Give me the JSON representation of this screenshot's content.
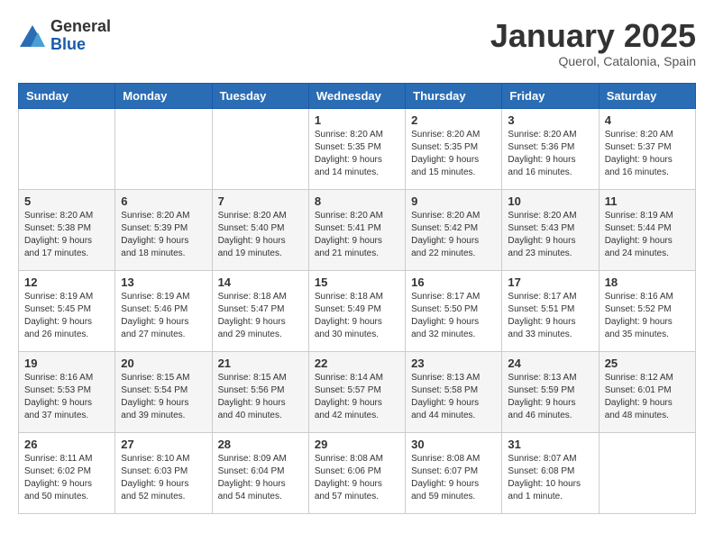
{
  "header": {
    "logo": {
      "general": "General",
      "blue": "Blue"
    },
    "title": "January 2025",
    "location": "Querol, Catalonia, Spain"
  },
  "weekdays": [
    "Sunday",
    "Monday",
    "Tuesday",
    "Wednesday",
    "Thursday",
    "Friday",
    "Saturday"
  ],
  "weeks": [
    [
      {
        "day": "",
        "info": ""
      },
      {
        "day": "",
        "info": ""
      },
      {
        "day": "",
        "info": ""
      },
      {
        "day": "1",
        "info": "Sunrise: 8:20 AM\nSunset: 5:35 PM\nDaylight: 9 hours\nand 14 minutes."
      },
      {
        "day": "2",
        "info": "Sunrise: 8:20 AM\nSunset: 5:35 PM\nDaylight: 9 hours\nand 15 minutes."
      },
      {
        "day": "3",
        "info": "Sunrise: 8:20 AM\nSunset: 5:36 PM\nDaylight: 9 hours\nand 16 minutes."
      },
      {
        "day": "4",
        "info": "Sunrise: 8:20 AM\nSunset: 5:37 PM\nDaylight: 9 hours\nand 16 minutes."
      }
    ],
    [
      {
        "day": "5",
        "info": "Sunrise: 8:20 AM\nSunset: 5:38 PM\nDaylight: 9 hours\nand 17 minutes."
      },
      {
        "day": "6",
        "info": "Sunrise: 8:20 AM\nSunset: 5:39 PM\nDaylight: 9 hours\nand 18 minutes."
      },
      {
        "day": "7",
        "info": "Sunrise: 8:20 AM\nSunset: 5:40 PM\nDaylight: 9 hours\nand 19 minutes."
      },
      {
        "day": "8",
        "info": "Sunrise: 8:20 AM\nSunset: 5:41 PM\nDaylight: 9 hours\nand 21 minutes."
      },
      {
        "day": "9",
        "info": "Sunrise: 8:20 AM\nSunset: 5:42 PM\nDaylight: 9 hours\nand 22 minutes."
      },
      {
        "day": "10",
        "info": "Sunrise: 8:20 AM\nSunset: 5:43 PM\nDaylight: 9 hours\nand 23 minutes."
      },
      {
        "day": "11",
        "info": "Sunrise: 8:19 AM\nSunset: 5:44 PM\nDaylight: 9 hours\nand 24 minutes."
      }
    ],
    [
      {
        "day": "12",
        "info": "Sunrise: 8:19 AM\nSunset: 5:45 PM\nDaylight: 9 hours\nand 26 minutes."
      },
      {
        "day": "13",
        "info": "Sunrise: 8:19 AM\nSunset: 5:46 PM\nDaylight: 9 hours\nand 27 minutes."
      },
      {
        "day": "14",
        "info": "Sunrise: 8:18 AM\nSunset: 5:47 PM\nDaylight: 9 hours\nand 29 minutes."
      },
      {
        "day": "15",
        "info": "Sunrise: 8:18 AM\nSunset: 5:49 PM\nDaylight: 9 hours\nand 30 minutes."
      },
      {
        "day": "16",
        "info": "Sunrise: 8:17 AM\nSunset: 5:50 PM\nDaylight: 9 hours\nand 32 minutes."
      },
      {
        "day": "17",
        "info": "Sunrise: 8:17 AM\nSunset: 5:51 PM\nDaylight: 9 hours\nand 33 minutes."
      },
      {
        "day": "18",
        "info": "Sunrise: 8:16 AM\nSunset: 5:52 PM\nDaylight: 9 hours\nand 35 minutes."
      }
    ],
    [
      {
        "day": "19",
        "info": "Sunrise: 8:16 AM\nSunset: 5:53 PM\nDaylight: 9 hours\nand 37 minutes."
      },
      {
        "day": "20",
        "info": "Sunrise: 8:15 AM\nSunset: 5:54 PM\nDaylight: 9 hours\nand 39 minutes."
      },
      {
        "day": "21",
        "info": "Sunrise: 8:15 AM\nSunset: 5:56 PM\nDaylight: 9 hours\nand 40 minutes."
      },
      {
        "day": "22",
        "info": "Sunrise: 8:14 AM\nSunset: 5:57 PM\nDaylight: 9 hours\nand 42 minutes."
      },
      {
        "day": "23",
        "info": "Sunrise: 8:13 AM\nSunset: 5:58 PM\nDaylight: 9 hours\nand 44 minutes."
      },
      {
        "day": "24",
        "info": "Sunrise: 8:13 AM\nSunset: 5:59 PM\nDaylight: 9 hours\nand 46 minutes."
      },
      {
        "day": "25",
        "info": "Sunrise: 8:12 AM\nSunset: 6:01 PM\nDaylight: 9 hours\nand 48 minutes."
      }
    ],
    [
      {
        "day": "26",
        "info": "Sunrise: 8:11 AM\nSunset: 6:02 PM\nDaylight: 9 hours\nand 50 minutes."
      },
      {
        "day": "27",
        "info": "Sunrise: 8:10 AM\nSunset: 6:03 PM\nDaylight: 9 hours\nand 52 minutes."
      },
      {
        "day": "28",
        "info": "Sunrise: 8:09 AM\nSunset: 6:04 PM\nDaylight: 9 hours\nand 54 minutes."
      },
      {
        "day": "29",
        "info": "Sunrise: 8:08 AM\nSunset: 6:06 PM\nDaylight: 9 hours\nand 57 minutes."
      },
      {
        "day": "30",
        "info": "Sunrise: 8:08 AM\nSunset: 6:07 PM\nDaylight: 9 hours\nand 59 minutes."
      },
      {
        "day": "31",
        "info": "Sunrise: 8:07 AM\nSunset: 6:08 PM\nDaylight: 10 hours\nand 1 minute."
      },
      {
        "day": "",
        "info": ""
      }
    ]
  ]
}
